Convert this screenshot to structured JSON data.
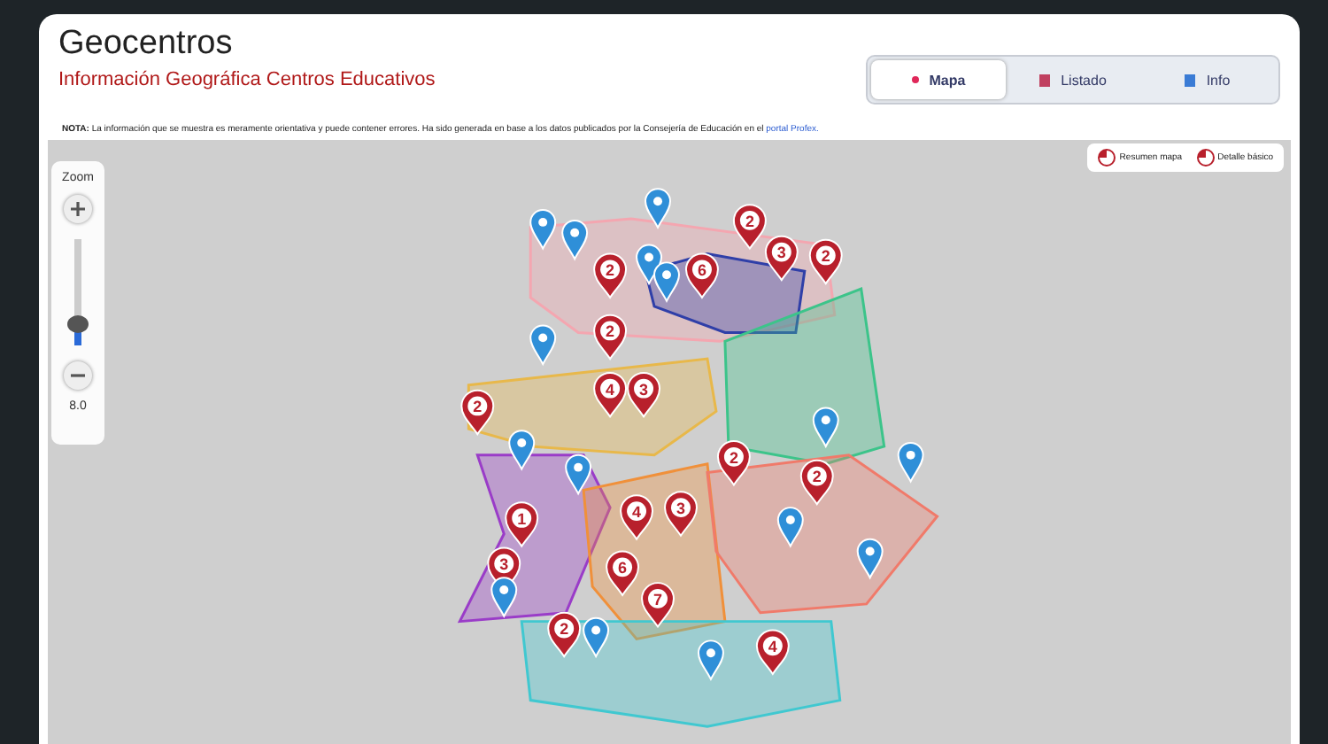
{
  "header": {
    "title": "Geocentros",
    "subtitle": "Información Geográfica Centros Educativos"
  },
  "tabs": [
    {
      "label": "Mapa",
      "selected": true
    },
    {
      "label": "Listado",
      "selected": false
    },
    {
      "label": "Info",
      "selected": false
    }
  ],
  "note": {
    "lead": "NOTA:",
    "text": "La información que se muestra es meramente orientativa y puede contener errores. Ha sido generada en base a los datos publicados por la Consejería de Educación en el",
    "link": "portal Profex."
  },
  "zoom": {
    "title": "Zoom",
    "level": 0.2,
    "value": "8.0"
  },
  "legend": [
    {
      "label": "Resumen mapa"
    },
    {
      "label": "Detalle básico"
    }
  ],
  "regions": [
    {
      "color": "#f4a6b0"
    },
    {
      "color": "#2f3fa8"
    },
    {
      "color": "#3cc48a"
    },
    {
      "color": "#e8b84a"
    },
    {
      "color": "#9a3cc8"
    },
    {
      "color": "#f0903a"
    },
    {
      "color": "#f07a6a"
    },
    {
      "color": "#40c8d0"
    }
  ],
  "markers": [
    {
      "kind": "school"
    },
    {
      "kind": "school"
    },
    {
      "kind": "school"
    },
    {
      "kind": "cluster",
      "label": "2"
    },
    {
      "kind": "cluster",
      "label": "3"
    },
    {
      "kind": "cluster",
      "label": "2"
    },
    {
      "kind": "cluster",
      "label": "6"
    },
    {
      "kind": "school"
    },
    {
      "kind": "school"
    },
    {
      "kind": "cluster",
      "label": "2"
    },
    {
      "kind": "school"
    },
    {
      "kind": "cluster",
      "label": "2"
    },
    {
      "kind": "cluster",
      "label": "4"
    },
    {
      "kind": "cluster",
      "label": "3"
    },
    {
      "kind": "cluster",
      "label": "2"
    },
    {
      "kind": "school"
    },
    {
      "kind": "school"
    },
    {
      "kind": "cluster",
      "label": "2"
    },
    {
      "kind": "cluster",
      "label": "2"
    },
    {
      "kind": "school"
    },
    {
      "kind": "school"
    },
    {
      "kind": "cluster",
      "label": "1"
    },
    {
      "kind": "cluster",
      "label": "4"
    },
    {
      "kind": "cluster",
      "label": "3"
    },
    {
      "kind": "school"
    },
    {
      "kind": "cluster",
      "label": "3"
    },
    {
      "kind": "cluster",
      "label": "6"
    },
    {
      "kind": "cluster",
      "label": "7"
    },
    {
      "kind": "school"
    },
    {
      "kind": "cluster",
      "label": "2"
    },
    {
      "kind": "school"
    },
    {
      "kind": "cluster",
      "label": "4"
    },
    {
      "kind": "school"
    },
    {
      "kind": "school"
    }
  ]
}
